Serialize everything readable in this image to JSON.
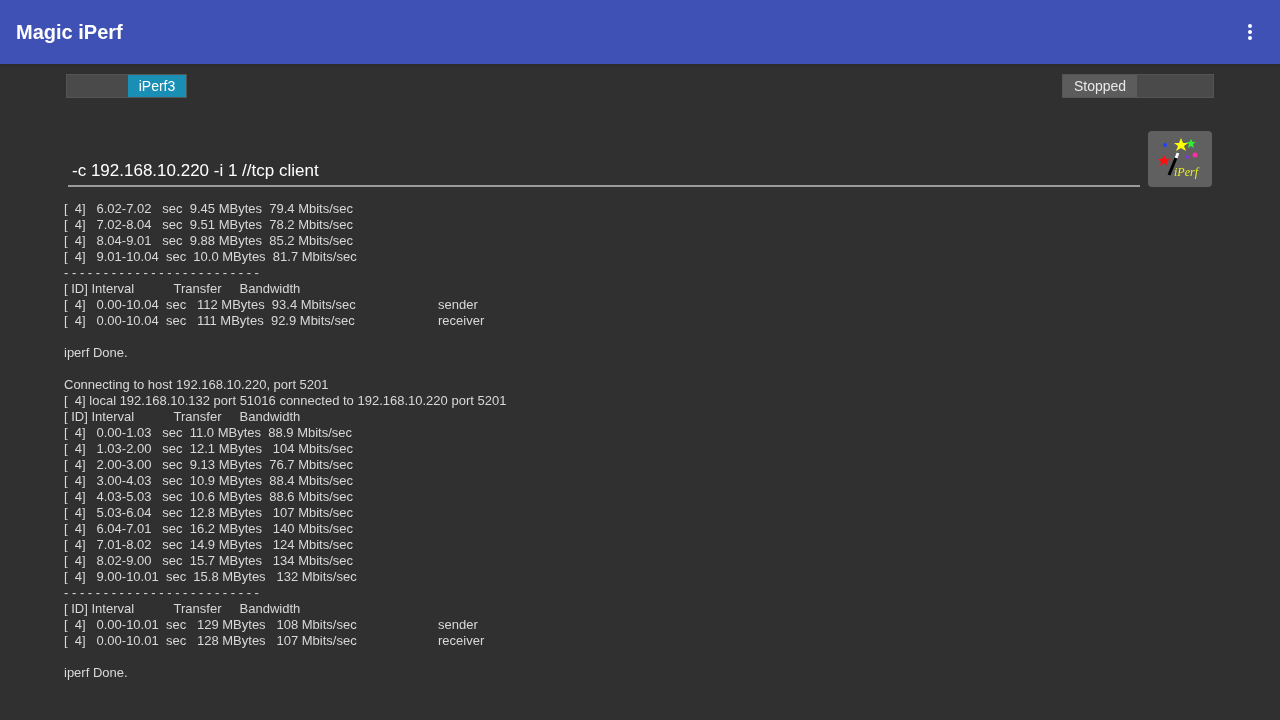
{
  "app_bar": {
    "title": "Magic iPerf"
  },
  "version_switch": {
    "label": "iPerf3",
    "on": true
  },
  "run_switch": {
    "label": "Stopped",
    "on": false
  },
  "command": {
    "value": "-c 192.168.10.220 -i 1 //tcp client"
  },
  "logo": {
    "text": "iPerf"
  },
  "output": [
    {
      "kind": "row",
      "text": "[  4]   6.02-7.02   sec  9.45 MBytes  79.4 Mbits/sec"
    },
    {
      "kind": "row",
      "text": "[  4]   7.02-8.04   sec  9.51 MBytes  78.2 Mbits/sec"
    },
    {
      "kind": "row",
      "text": "[  4]   8.04-9.01   sec  9.88 MBytes  85.2 Mbits/sec"
    },
    {
      "kind": "row",
      "text": "[  4]   9.01-10.04  sec  10.0 MBytes  81.7 Mbits/sec"
    },
    {
      "kind": "divider",
      "text": "- - - - - - - - - - - - - - - - - - - - - - - - -"
    },
    {
      "kind": "row",
      "text": "[ ID] Interval           Transfer     Bandwidth"
    },
    {
      "kind": "row",
      "text": "[  4]   0.00-10.04  sec   112 MBytes  93.4 Mbits/sec",
      "role": "sender"
    },
    {
      "kind": "row",
      "text": "[  4]   0.00-10.04  sec   111 MBytes  92.9 Mbits/sec",
      "role": "receiver"
    },
    {
      "kind": "blank"
    },
    {
      "kind": "row",
      "text": "iperf Done."
    },
    {
      "kind": "blank"
    },
    {
      "kind": "row",
      "text": "Connecting to host 192.168.10.220, port 5201"
    },
    {
      "kind": "row",
      "text": "[  4] local 192.168.10.132 port 51016 connected to 192.168.10.220 port 5201"
    },
    {
      "kind": "row",
      "text": "[ ID] Interval           Transfer     Bandwidth"
    },
    {
      "kind": "row",
      "text": "[  4]   0.00-1.03   sec  11.0 MBytes  88.9 Mbits/sec"
    },
    {
      "kind": "row",
      "text": "[  4]   1.03-2.00   sec  12.1 MBytes   104 Mbits/sec"
    },
    {
      "kind": "row",
      "text": "[  4]   2.00-3.00   sec  9.13 MBytes  76.7 Mbits/sec"
    },
    {
      "kind": "row",
      "text": "[  4]   3.00-4.03   sec  10.9 MBytes  88.4 Mbits/sec"
    },
    {
      "kind": "row",
      "text": "[  4]   4.03-5.03   sec  10.6 MBytes  88.6 Mbits/sec"
    },
    {
      "kind": "row",
      "text": "[  4]   5.03-6.04   sec  12.8 MBytes   107 Mbits/sec"
    },
    {
      "kind": "row",
      "text": "[  4]   6.04-7.01   sec  16.2 MBytes   140 Mbits/sec"
    },
    {
      "kind": "row",
      "text": "[  4]   7.01-8.02   sec  14.9 MBytes   124 Mbits/sec"
    },
    {
      "kind": "row",
      "text": "[  4]   8.02-9.00   sec  15.7 MBytes   134 Mbits/sec"
    },
    {
      "kind": "row",
      "text": "[  4]   9.00-10.01  sec  15.8 MBytes   132 Mbits/sec"
    },
    {
      "kind": "divider",
      "text": "- - - - - - - - - - - - - - - - - - - - - - - - -"
    },
    {
      "kind": "row",
      "text": "[ ID] Interval           Transfer     Bandwidth"
    },
    {
      "kind": "row",
      "text": "[  4]   0.00-10.01  sec   129 MBytes   108 Mbits/sec",
      "role": "sender"
    },
    {
      "kind": "row",
      "text": "[  4]   0.00-10.01  sec   128 MBytes   107 Mbits/sec",
      "role": "receiver"
    },
    {
      "kind": "blank"
    },
    {
      "kind": "row",
      "text": "iperf Done."
    }
  ]
}
